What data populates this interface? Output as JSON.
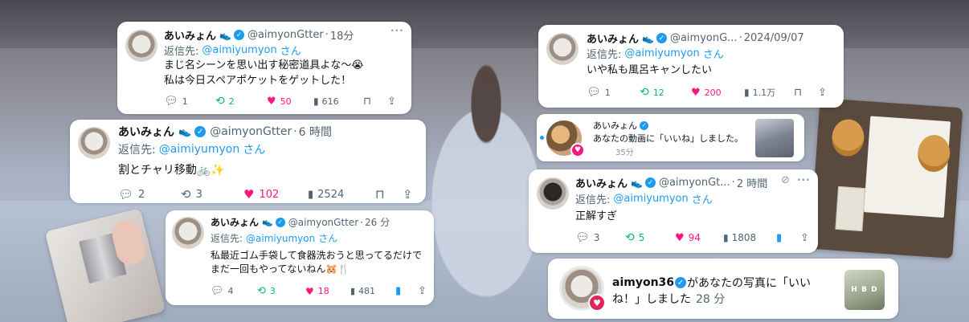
{
  "tweets": [
    {
      "name": "あいみょん",
      "handle": "@aimyonGtter",
      "time": "18分",
      "reply_prefix": "返信先:",
      "reply_to": "@aimiyumyon",
      "reply_suffix": "さん",
      "text_lines": [
        "まじ名シーンを思い出す秘密道具よな〜😭",
        "私は今日スペアポケットをゲットした！"
      ],
      "replies": "1",
      "retweets": "2",
      "likes": "50",
      "views": "616"
    },
    {
      "name": "あいみょん",
      "handle": "@aimyonGtter",
      "time": "6 時間",
      "reply_prefix": "返信先:",
      "reply_to": "@aimiyumyon",
      "reply_suffix": "さん",
      "text_lines": [
        "割とチャリ移動🚲✨"
      ],
      "replies": "2",
      "retweets": "3",
      "likes": "102",
      "views": "2524"
    },
    {
      "name": "あいみょん",
      "handle": "@aimyonGtter",
      "time": "26 分",
      "reply_prefix": "返信先:",
      "reply_to": "@aimiyumyon",
      "reply_suffix": "さん",
      "text_lines": [
        "私最近ゴム手袋して食器洗おうと思ってるだけで",
        "まだ一回もやってないねん🐹🍴"
      ],
      "replies": "4",
      "retweets": "3",
      "likes": "18",
      "views": "481"
    },
    {
      "name": "あいみょん",
      "handle": "@aimyonG...",
      "time": "2024/09/07",
      "reply_prefix": "返信先:",
      "reply_to": "@aimiyumyon",
      "reply_suffix": "さん",
      "text_lines": [
        "いや私も風呂キャンしたい"
      ],
      "replies": "1",
      "retweets": "12",
      "likes": "200",
      "views": "1.1万"
    },
    {
      "name": "あいみょん",
      "handle": "@aimyonGt...",
      "time": "2 時間",
      "reply_prefix": "返信先:",
      "reply_to": "@aimiyumyon",
      "reply_suffix": "さん",
      "text_lines": [
        "正解すぎ"
      ],
      "replies": "3",
      "retweets": "5",
      "likes": "94",
      "views": "1808"
    }
  ],
  "separator": "·",
  "more": "···",
  "notifications": [
    {
      "name": "あいみょん",
      "message": "あなたの動画に「いいね」しました。",
      "time": "35分"
    },
    {
      "user": "aimyon36",
      "message_line1": "があなたの写真に「いい",
      "message_line2": "ね！」しました",
      "time": "28 分",
      "thumb_text": "H B D"
    }
  ],
  "icons": {
    "reply": "reply-icon",
    "retweet": "retweet-icon",
    "like": "heart-icon",
    "views": "views-icon",
    "bookmark": "bookmark-icon",
    "share": "share-icon",
    "verified": "verified-badge-icon"
  },
  "colors": {
    "verified": "#1d9bf0",
    "retweet": "#00ba7c",
    "like": "#f91880",
    "muted": "#536471"
  }
}
